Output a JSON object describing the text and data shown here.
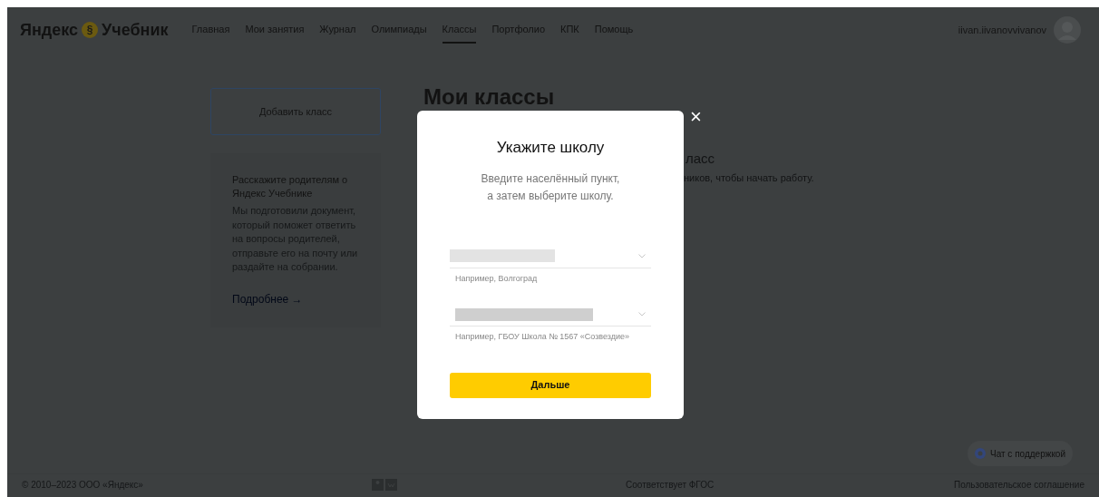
{
  "header": {
    "logo_left": "Яндекс",
    "logo_mark": "§",
    "logo_right": "Учебник",
    "nav": [
      {
        "label": "Главная",
        "selected": false
      },
      {
        "label": "Мои занятия",
        "selected": false
      },
      {
        "label": "Журнал",
        "selected": false
      },
      {
        "label": "Олимпиады",
        "selected": false
      },
      {
        "label": "Классы",
        "selected": true
      },
      {
        "label": "Портфолио",
        "selected": false
      },
      {
        "label": "КПК",
        "selected": false
      },
      {
        "label": "Помощь",
        "selected": false
      }
    ],
    "username": "iivan.iivanovvivanov"
  },
  "sidebar": {
    "add_button": "Добавить класс",
    "info_title": "Расскажите родителям о Яндекс Учебнике",
    "info_text": "Мы подготовили документ, который поможет ответить на вопросы родителей, отправьте его на почту или раздайте на собрании.",
    "info_link": "Подробнее →"
  },
  "main": {
    "title": "Мои классы",
    "fragment_heading": "ласс",
    "fragment_text": "ников, чтобы начать работу."
  },
  "modal": {
    "title": "Укажите школу",
    "subtitle_lines": [
      "Введите населённый пункт,",
      "а затем выберите школу."
    ],
    "fields": [
      {
        "hint": "Например, Волгоград"
      },
      {
        "hint": "Например, ГБОУ Школа № 1567 «Созвездие»"
      }
    ],
    "button": "Дальше",
    "close": "×"
  },
  "chat_button": "Чат с поддержкой",
  "footer": {
    "copyright": "© 2010–2023 ООО «Яндекс»",
    "fgos": "Соответствует ФГОС",
    "agreement": "Пользовательское соглашение"
  }
}
